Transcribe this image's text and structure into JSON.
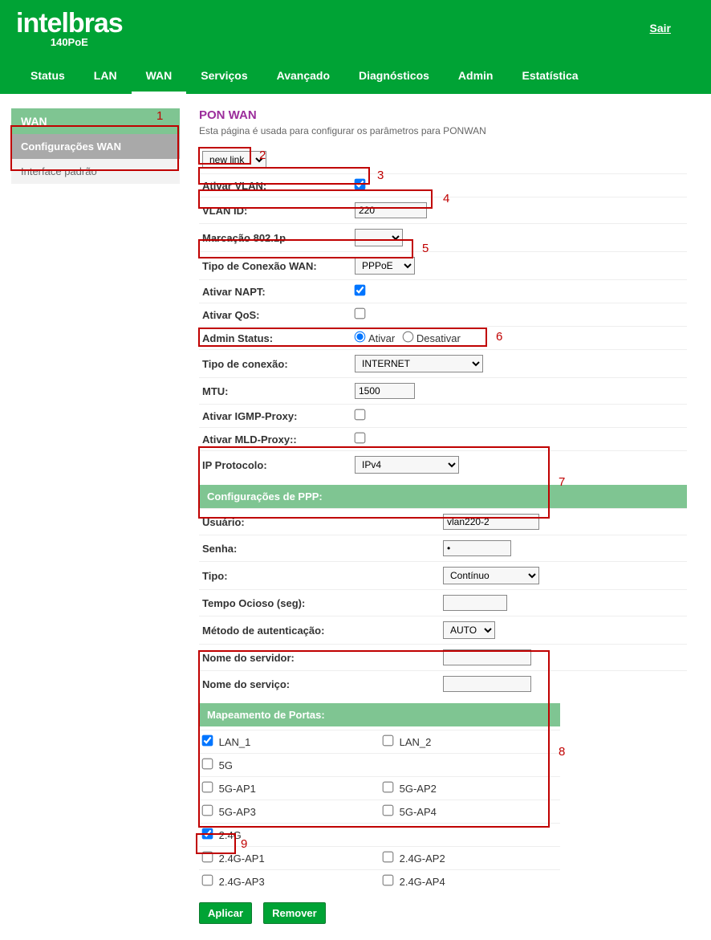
{
  "header": {
    "brand": "intelbras",
    "model": "140PoE",
    "logout": "Sair"
  },
  "nav": {
    "items": [
      "Status",
      "LAN",
      "WAN",
      "Serviços",
      "Avançado",
      "Diagnósticos",
      "Admin",
      "Estatística"
    ],
    "active_index": 2
  },
  "sidebar": {
    "head": "WAN",
    "items": [
      {
        "label": "Configurações WAN",
        "active": true
      },
      {
        "label": "Interface padrão",
        "active": false
      }
    ]
  },
  "page": {
    "title": "PON WAN",
    "desc": "Esta página é usada para configurar os parâmetros para PONWAN",
    "link_select": "new link",
    "fields": {
      "enable_vlan_label": "Ativar VLAN:",
      "enable_vlan_checked": true,
      "vlan_id_label": "VLAN ID:",
      "vlan_id_value": "220",
      "marking_label": "Marcação 802.1p",
      "marking_value": "",
      "wan_conn_type_label": "Tipo de Conexão WAN:",
      "wan_conn_type_value": "PPPoE",
      "napt_label": "Ativar NAPT:",
      "napt_checked": true,
      "qos_label": "Ativar QoS:",
      "qos_checked": false,
      "admin_status_label": "Admin Status:",
      "admin_status_value": "Ativar",
      "admin_status_opt1": "Ativar",
      "admin_status_opt2": "Desativar",
      "conn_type_label": "Tipo de conexão:",
      "conn_type_value": "INTERNET",
      "mtu_label": "MTU:",
      "mtu_value": "1500",
      "igmp_label": "Ativar IGMP-Proxy:",
      "igmp_checked": false,
      "mld_label": "Ativar MLD-Proxy::",
      "mld_checked": false,
      "ip_proto_label": "IP Protocolo:",
      "ip_proto_value": "IPv4"
    },
    "ppp": {
      "head": "Configurações de PPP:",
      "user_label": "Usuário:",
      "user_value": "vlan220-2",
      "pass_label": "Senha:",
      "pass_value": "•",
      "type_label": "Tipo:",
      "type_value": "Contínuo",
      "idle_label": "Tempo Ocioso (seg):",
      "idle_value": "",
      "auth_label": "Método de autenticação:",
      "auth_value": "AUTO",
      "server_name_label": "Nome do servidor:",
      "server_name_value": "",
      "service_name_label": "Nome do serviço:",
      "service_name_value": ""
    },
    "ports": {
      "head": "Mapeamento de Portas:",
      "rows": [
        [
          {
            "label": "LAN_1",
            "checked": true
          },
          {
            "label": "LAN_2",
            "checked": false
          }
        ],
        [
          {
            "label": "5G",
            "checked": false
          },
          null
        ],
        [
          {
            "label": "5G-AP1",
            "checked": false
          },
          {
            "label": "5G-AP2",
            "checked": false
          }
        ],
        [
          {
            "label": "5G-AP3",
            "checked": false
          },
          {
            "label": "5G-AP4",
            "checked": false
          }
        ],
        [
          {
            "label": "2.4G",
            "checked": true
          },
          null
        ],
        [
          {
            "label": "2.4G-AP1",
            "checked": false
          },
          {
            "label": "2.4G-AP2",
            "checked": false
          }
        ],
        [
          {
            "label": "2.4G-AP3",
            "checked": false
          },
          {
            "label": "2.4G-AP4",
            "checked": false
          }
        ]
      ]
    },
    "buttons": {
      "apply": "Aplicar",
      "remove": "Remover"
    }
  },
  "annotations": {
    "n1": "1",
    "n2": "2",
    "n3": "3",
    "n4": "4",
    "n5": "5",
    "n6": "6",
    "n7": "7",
    "n8": "8",
    "n9": "9"
  }
}
